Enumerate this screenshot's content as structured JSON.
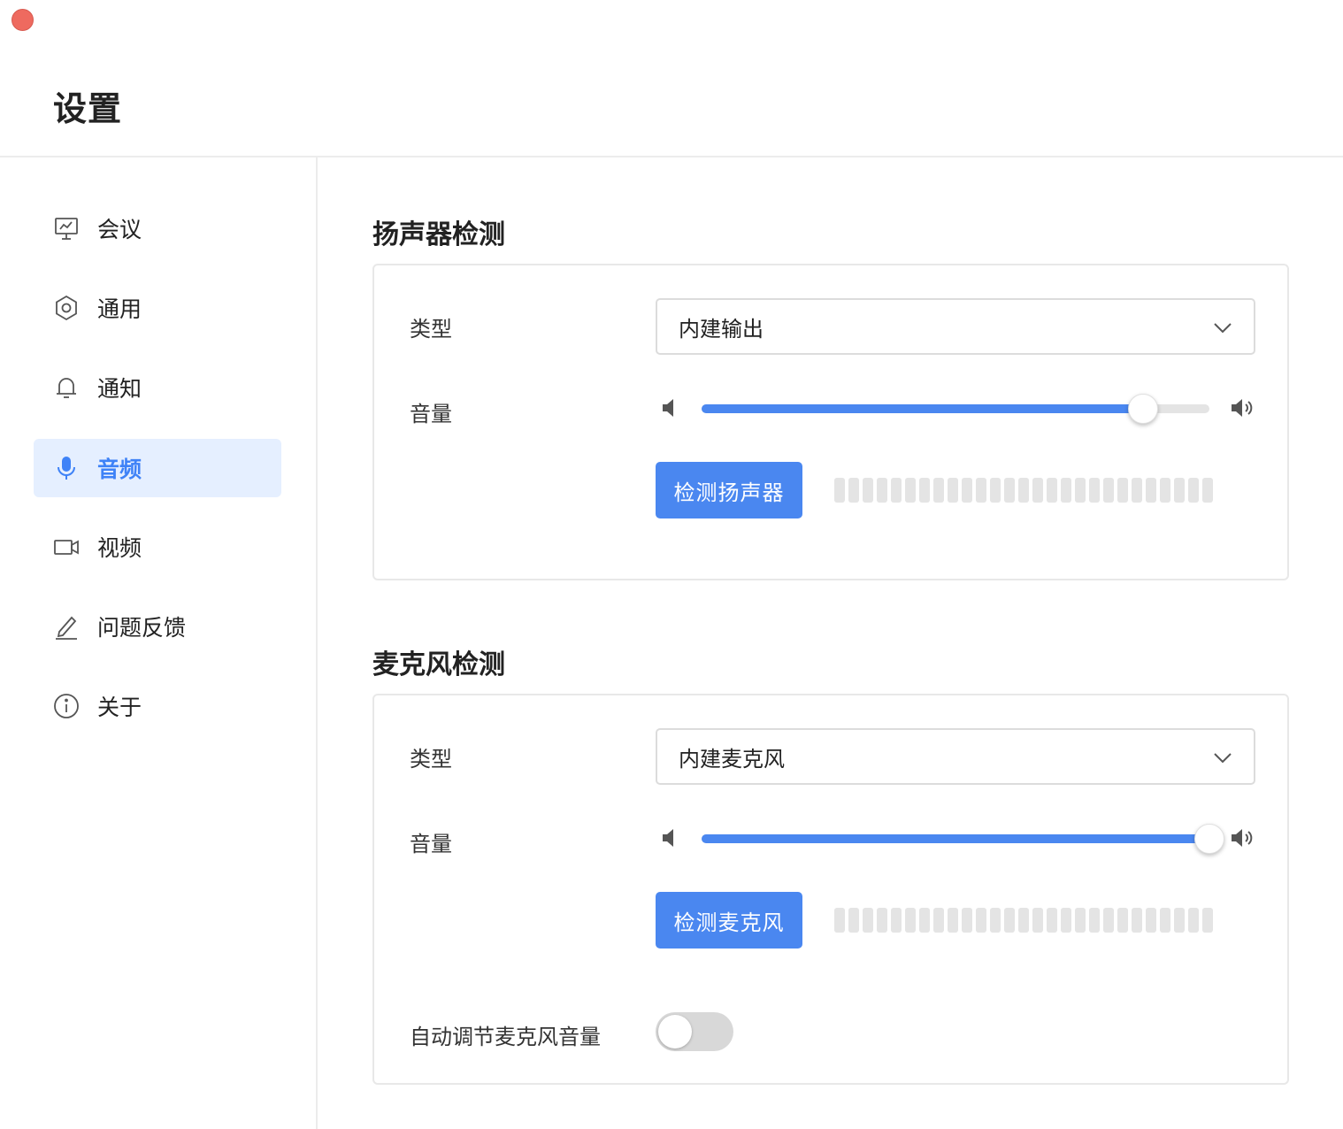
{
  "window": {
    "title": "设置"
  },
  "sidebar": {
    "items": [
      {
        "label": "会议",
        "icon": "presentation-icon",
        "active": false
      },
      {
        "label": "通用",
        "icon": "gear-icon",
        "active": false
      },
      {
        "label": "通知",
        "icon": "bell-icon",
        "active": false
      },
      {
        "label": "音频",
        "icon": "microphone-icon",
        "active": true
      },
      {
        "label": "视频",
        "icon": "video-camera-icon",
        "active": false
      },
      {
        "label": "问题反馈",
        "icon": "pencil-icon",
        "active": false
      },
      {
        "label": "关于",
        "icon": "info-icon",
        "active": false
      }
    ]
  },
  "speaker": {
    "title": "扬声器检测",
    "type_label": "类型",
    "type_value": "内建输出",
    "volume_label": "音量",
    "volume_fraction": 0.87,
    "test_button": "检测扬声器",
    "meter_level": 0
  },
  "microphone": {
    "title": "麦克风检测",
    "type_label": "类型",
    "type_value": "内建麦克风",
    "volume_label": "音量",
    "volume_fraction": 1.0,
    "test_button": "检测麦克风",
    "meter_level": 0,
    "auto_adjust_label": "自动调节麦克风音量",
    "auto_adjust_on": false
  },
  "colors": {
    "accent": "#4a87f0",
    "active_nav_bg": "#e5efff",
    "active_nav_text": "#3e82f7",
    "close_button": "#ee6a5f"
  }
}
